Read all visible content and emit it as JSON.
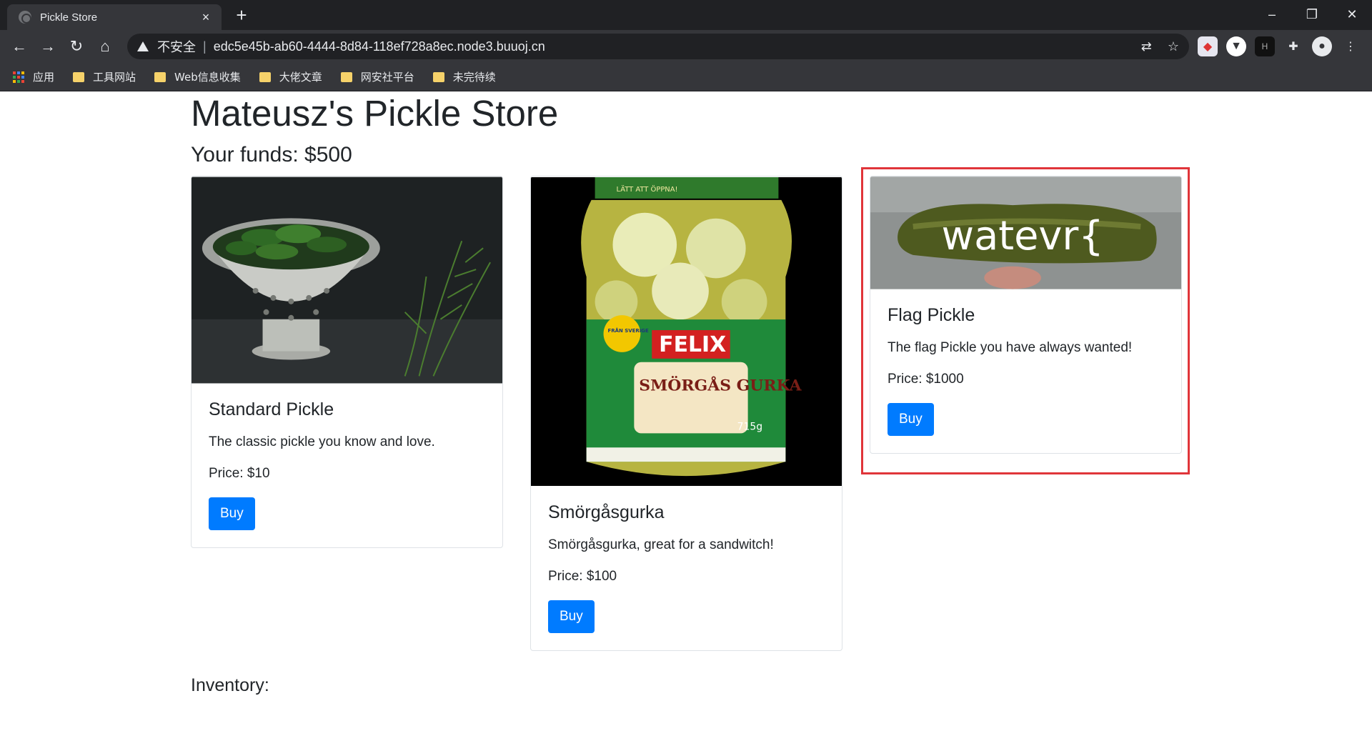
{
  "browser": {
    "tab_title": "Pickle Store",
    "tab_close": "×",
    "new_tab": "+",
    "window_controls": [
      "–",
      "❐",
      "✕"
    ],
    "security_label": "不安全",
    "url": "edc5e45b-ab60-4444-8d84-118ef728a8ec.node3.buuoj.cn",
    "bookmarks": [
      "应用",
      "工具网站",
      "Web信息收集",
      "大佬文章",
      "网安社平台",
      "未完待续"
    ]
  },
  "page": {
    "title": "Mateusz's Pickle Store",
    "funds": "Your funds: $500",
    "inventory_label": "Inventory:"
  },
  "products": [
    {
      "name": "Standard Pickle",
      "description": "The classic pickle you know and love.",
      "price": "Price: $10",
      "buy_label": "Buy"
    },
    {
      "name": "Smörgåsgurka",
      "description": "Smörgåsgurka, great for a sandwitch!",
      "price": "Price: $100",
      "buy_label": "Buy",
      "jar_label_brand": "FELIX",
      "jar_label_name": "SMÖRGÅS GURKA",
      "jar_label_tag": "FRÅN SVERIGE",
      "jar_lid_text": "LÄTT ATT ÖPPNA!",
      "jar_weight": "715g"
    },
    {
      "name": "Flag Pickle",
      "description": "The flag Pickle you have always wanted!",
      "price": "Price: $1000",
      "buy_label": "Buy",
      "image_text": "watevr{"
    }
  ],
  "colors": {
    "accent": "#007bff",
    "highlight": "#e0353a"
  }
}
